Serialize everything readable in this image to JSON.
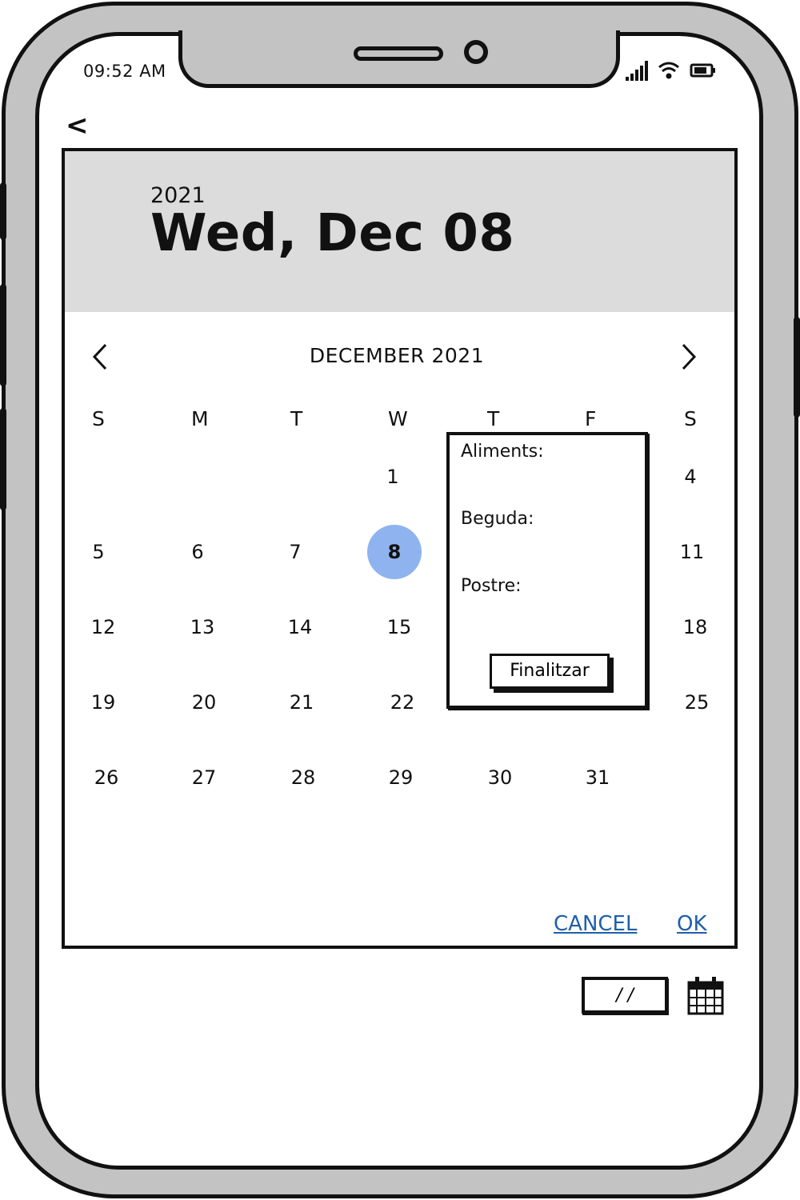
{
  "status_bar": {
    "time": "09:52 AM"
  },
  "datepicker": {
    "year": "2021",
    "selected_date_label": "Wed, Dec 08",
    "month_label": "DECEMBER 2021",
    "weekdays": [
      "S",
      "M",
      "T",
      "W",
      "T",
      "F",
      "S"
    ],
    "days": [
      "1",
      "4",
      "5",
      "6",
      "7",
      "8",
      "11",
      "12",
      "13",
      "14",
      "15",
      "18",
      "19",
      "20",
      "21",
      "22",
      "25",
      "26",
      "27",
      "28",
      "29",
      "30",
      "31"
    ],
    "selected_day": "8",
    "cancel_label": "CANCEL",
    "ok_label": "OK"
  },
  "popup": {
    "aliments_label": "Aliments:",
    "beguda_label": "Beguda:",
    "postre_label": "Postre:",
    "finalitzar_label": "Finalitzar"
  },
  "date_field": {
    "value": "/ /"
  },
  "colors": {
    "selected_day": "#8fb3ef",
    "header_bg": "#dcdcdc",
    "link": "#1f5fa8",
    "device_frame": "#c3c3c3"
  },
  "icons": [
    "chevron-left-icon",
    "chevron-right-icon",
    "signal-icon",
    "wifi-icon",
    "battery-icon",
    "calendar-icon"
  ]
}
